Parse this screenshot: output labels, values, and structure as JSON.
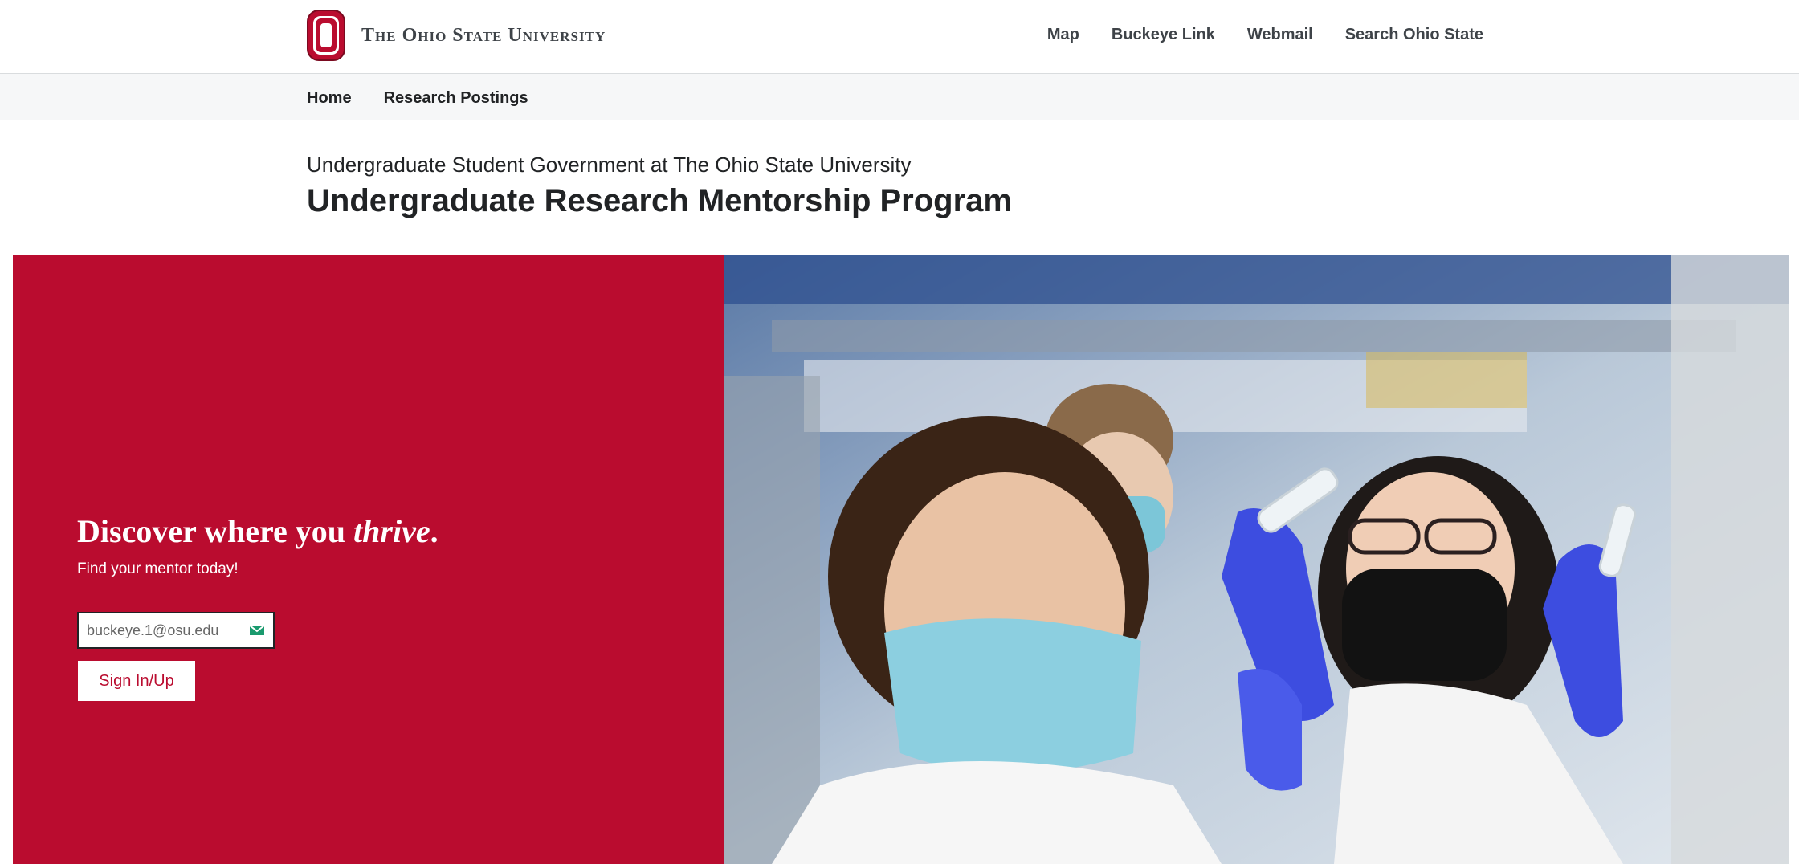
{
  "header": {
    "university_name": "The Ohio State University",
    "utility_links": [
      "Map",
      "Buckeye Link",
      "Webmail",
      "Search Ohio State"
    ]
  },
  "subnav": {
    "items": [
      "Home",
      "Research Postings"
    ]
  },
  "page": {
    "org_title": "Undergraduate Student Government at The Ohio State University",
    "title": "Undergraduate Research Mentorship Program"
  },
  "hero": {
    "tagline_prefix": "Discover where you ",
    "tagline_emphasis": "thrive",
    "tagline_suffix": ".",
    "subtagline": "Find your mentor today!",
    "email_placeholder": "buckeye.1@osu.edu",
    "signin_label": "Sign In/Up",
    "image_icon": "lab-researchers-photo"
  },
  "colors": {
    "scarlet": "#ba0c2f",
    "gray_text": "#3e4348",
    "subnav_bg": "#f6f7f8"
  }
}
